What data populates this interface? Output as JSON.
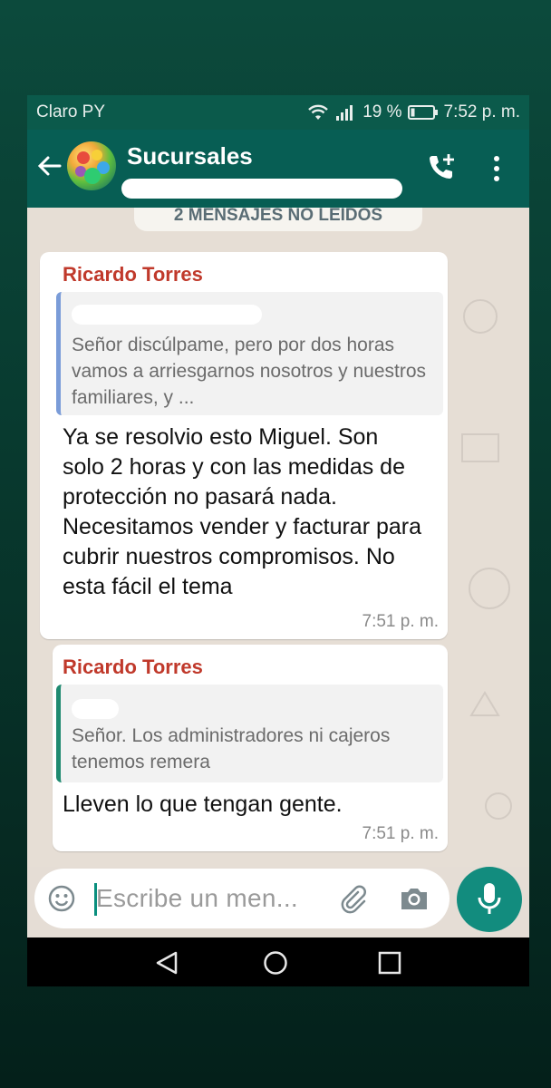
{
  "status_bar": {
    "carrier": "Claro PY",
    "battery": "19 %",
    "time": "7:52 p. m."
  },
  "header": {
    "title": "Sucursales"
  },
  "unread_banner": "2 MENSAJES NO LEIDOS",
  "messages": [
    {
      "sender": "Ricardo Torres",
      "quoted_text": "Señor discúlpame, pero por dos horas vamos a arriesgarnos nosotros y nuestros familiares, y ...",
      "text": "Ya se resolvio esto Miguel. Son solo 2 horas y con las medidas de protección no pasará nada. Necesitamos vender y facturar para cubrir nuestros compromisos. No esta fácil el tema",
      "time": "7:51 p. m."
    },
    {
      "sender": "Ricardo Torres",
      "quoted_text": "Señor. Los administradores ni cajeros tenemos remera",
      "text": "Lleven lo que tengan gente.",
      "time": "7:51 p. m."
    }
  ],
  "composer": {
    "placeholder": "Escribe un men..."
  },
  "colors": {
    "app_bar": "#075e54",
    "accent": "#128c7e",
    "sender_name": "#c0392b",
    "chat_background": "#e6ded5"
  }
}
